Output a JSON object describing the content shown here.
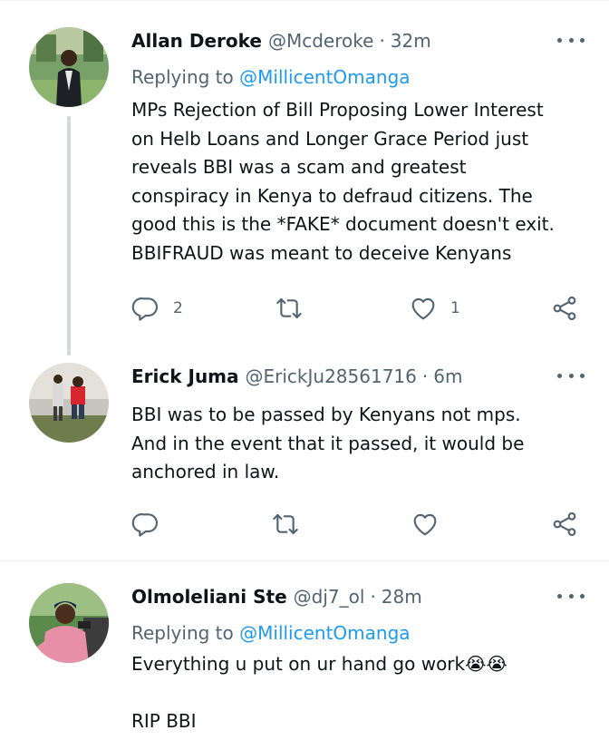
{
  "tweets": [
    {
      "name": "Allan Deroke",
      "handle": "@Mcderoke",
      "separator": "·",
      "time": "32m",
      "reply_prefix": "Replying to",
      "reply_to": "@MillicentOmanga",
      "text": "MPs Rejection of Bill Proposing Lower Interest\non Helb Loans and Longer Grace Period just\nreveals BBI was a scam and greatest\nconspiracy in Kenya to defraud citizens. The\ngood this is the *FAKE* document doesn't exit.\nBBIFRAUD was meant to deceive Kenyans",
      "reply_count": "2",
      "retweet_count": "",
      "like_count": "1",
      "icons": {
        "reply": "reply-icon",
        "retweet": "retweet-icon",
        "like": "heart-icon",
        "share": "share-icon",
        "more": "more-icon"
      }
    },
    {
      "name": "Erick Juma",
      "handle": "@ErickJu28561716",
      "separator": "·",
      "time": "6m",
      "text": "BBI was to be passed by Kenyans not mps.\nAnd in the event that it passed, it would be\nanchored in law.",
      "reply_count": "",
      "retweet_count": "",
      "like_count": "",
      "icons": {
        "reply": "reply-icon",
        "retweet": "retweet-icon",
        "like": "heart-icon",
        "share": "share-icon",
        "more": "more-icon"
      }
    },
    {
      "name": "Olmoleliani Ste",
      "handle": "@dj7_ol",
      "separator": "·",
      "time": "28m",
      "reply_prefix": "Replying to",
      "reply_to": "@MillicentOmanga",
      "text": "Everything u put on ur hand go work😭😭\n\nRIP BBI",
      "icons": {
        "more": "more-icon"
      }
    }
  ],
  "colors": {
    "text": "#0f1419",
    "secondary": "#536471",
    "link": "#1d9bf0",
    "divider": "#eff3f4",
    "thread_line": "#cfd9de"
  }
}
